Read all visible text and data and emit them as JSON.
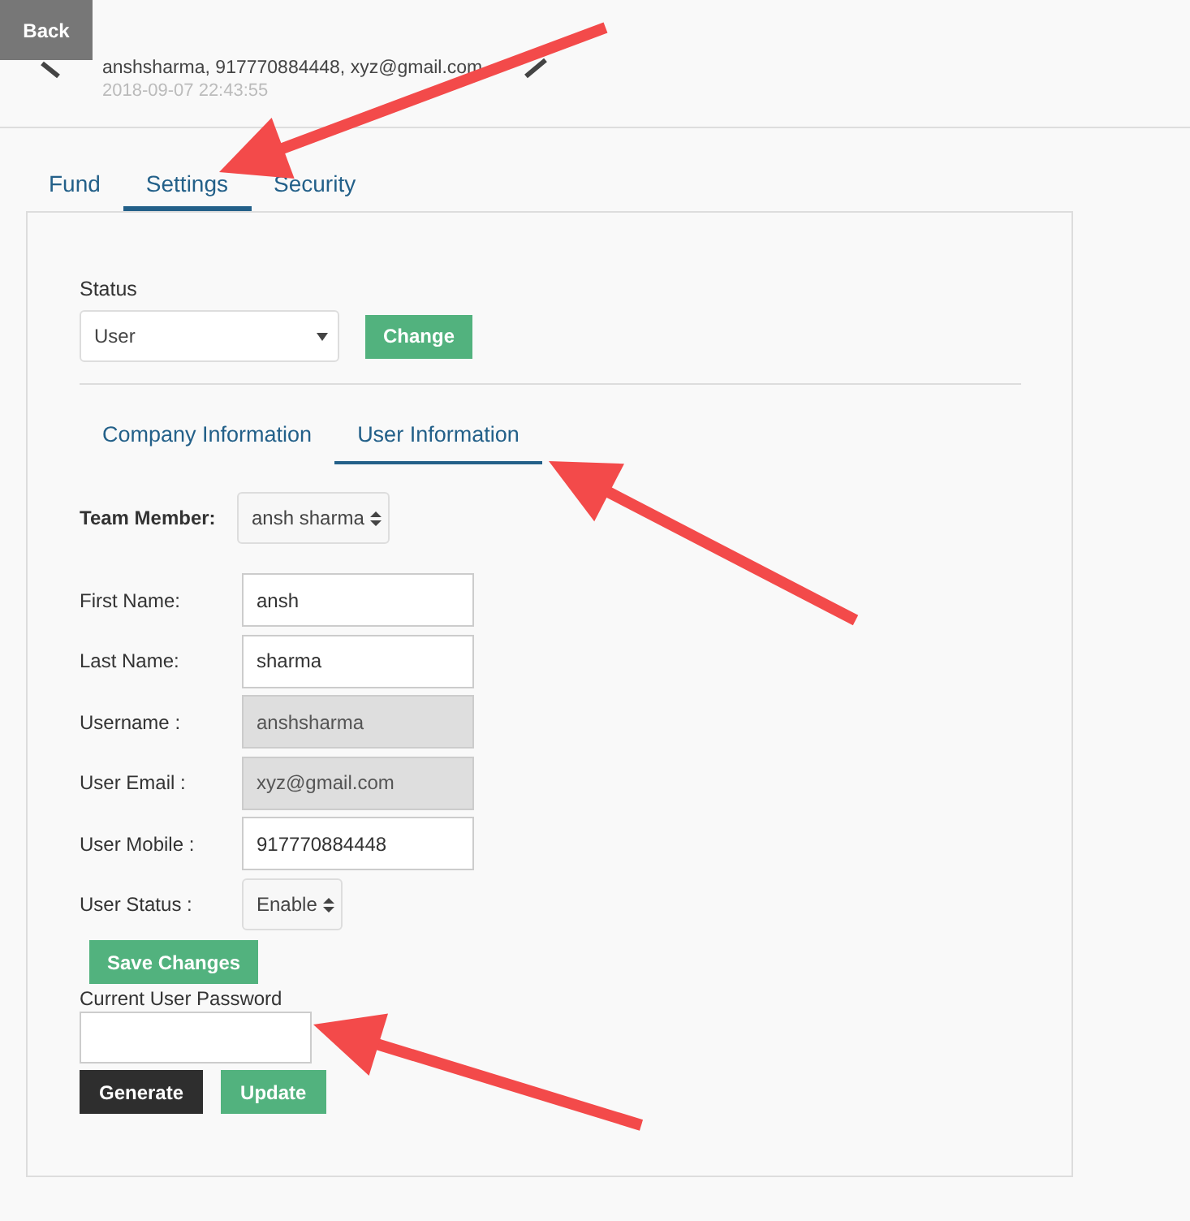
{
  "back_button": "Back",
  "header": {
    "summary": "anshsharma, 917770884448, xyz@gmail.com",
    "timestamp": "2018-09-07 22:43:55"
  },
  "tabs": [
    {
      "label": "Fund",
      "selected": false
    },
    {
      "label": "Settings",
      "selected": true
    },
    {
      "label": "Security",
      "selected": false
    }
  ],
  "status": {
    "label": "Status",
    "value": "User",
    "button": "Change"
  },
  "sub_tabs": [
    {
      "label": "Company Information",
      "selected": false
    },
    {
      "label": "User Information",
      "selected": true
    }
  ],
  "team_member": {
    "label": "Team Member:",
    "value": "ansh sharma"
  },
  "fields": [
    {
      "label": "First Name:",
      "value": "ansh",
      "kind": "input",
      "disabled": false
    },
    {
      "label": "Last Name:",
      "value": "sharma",
      "kind": "input",
      "disabled": false
    },
    {
      "label": "Username :",
      "value": "anshsharma",
      "kind": "input",
      "disabled": true
    },
    {
      "label": "User Email :",
      "value": "xyz@gmail.com",
      "kind": "input",
      "disabled": true
    },
    {
      "label": "User Mobile :",
      "value": "917770884448",
      "kind": "input",
      "disabled": false
    },
    {
      "label": "User Status :",
      "value": "Enable",
      "kind": "select"
    }
  ],
  "save_button": "Save Changes",
  "password": {
    "label": "Current User Password"
  },
  "actions": [
    {
      "label": "Generate",
      "kind": "dark"
    },
    {
      "label": "Update",
      "kind": "green"
    }
  ]
}
